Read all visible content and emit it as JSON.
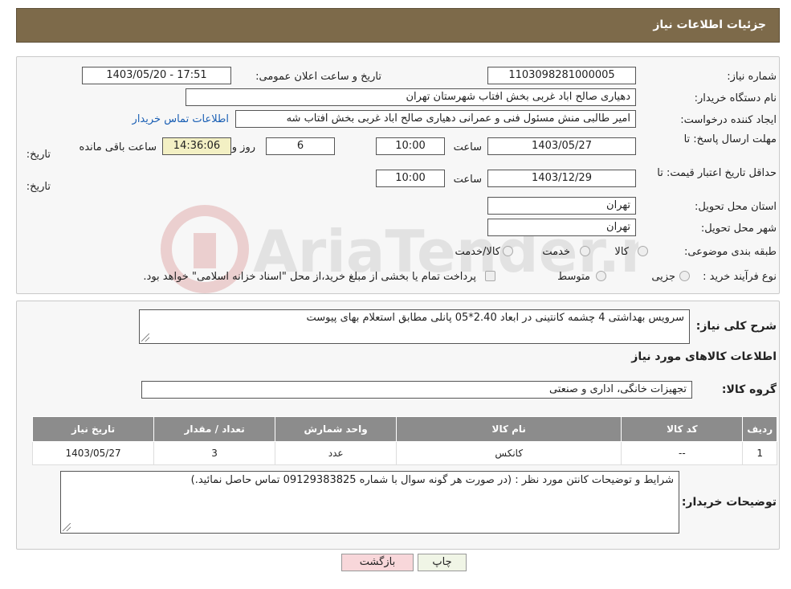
{
  "header": {
    "title": "جزئیات اطلاعات نیاز"
  },
  "watermark": {
    "text": "AriaTender.neT"
  },
  "form": {
    "need_number_label": "شماره نیاز:",
    "need_number_value": "1103098281000005",
    "announce_label": "تاریخ و ساعت اعلان عمومی:",
    "announce_value": "1403/05/20 - 17:51",
    "buyer_org_label": "نام دستگاه خریدار:",
    "buyer_org_value": "دهیاری صالح اباد غربی بخش افتاب شهرستان تهران",
    "creator_label": "ایجاد کننده درخواست:",
    "creator_value": "امیر طالبی منش مسئول فنی و عمرانی دهیاری صالح اباد غربی بخش افتاب شه",
    "contact_link": "اطلاعات تماس خریدار",
    "deadline_label_1": "مهلت ارسال پاسخ: تا",
    "deadline_label_2": "تاریخ:",
    "deadline_date": "1403/05/27",
    "time_label": "ساعت",
    "deadline_time": "10:00",
    "days_value": "6",
    "days_label": "روز و",
    "remaining_time": "14:36:06",
    "remaining_label": "ساعت باقی مانده",
    "validity_label_1": "حداقل تاریخ اعتبار قیمت: تا",
    "validity_label_2": "تاریخ:",
    "validity_date": "1403/12/29",
    "validity_time_label": "ساعت",
    "validity_time": "10:00",
    "province_label": "استان محل تحویل:",
    "province_value": "تهران",
    "city_label": "شهر محل تحویل:",
    "city_value": "تهران",
    "category_label": "طبقه بندی موضوعی:",
    "category_options": [
      "کالا",
      "خدمت",
      "کالا/خدمت"
    ],
    "purchase_type_label": "نوع فرآیند خرید :",
    "purchase_type_options": [
      "جزیی",
      "متوسط"
    ],
    "purchase_note": "پرداخت تمام یا بخشی از مبلغ خرید،از محل \"اسناد خزانه اسلامی\" خواهد بود."
  },
  "description": {
    "label": "شرح کلی نیاز:",
    "value": "سرویس بهداشتی 4 چشمه کانتینی در ابعاد 2.40*05 پانلی مطابق استعلام بهای پیوست"
  },
  "goods": {
    "section_title": "اطلاعات کالاهای مورد نیاز",
    "group_label": "گروه کالا:",
    "group_value": "تجهیزات خانگی، اداری و صنعتی",
    "columns": [
      "ردیف",
      "کد کالا",
      "نام کالا",
      "واحد شمارش",
      "تعداد / مقدار",
      "تاریخ نیاز"
    ],
    "rows": [
      [
        "1",
        "--",
        "کانکس",
        "عدد",
        "3",
        "1403/05/27"
      ]
    ]
  },
  "buyer_notes": {
    "label": "توضیحات خریدار:",
    "value": "شرایط و توضیحات کانتن  مورد نظر : (در صورت هر گونه سوال با شماره 09129383825 تماس حاصل نمائید.)"
  },
  "buttons": {
    "print": "چاپ",
    "back": "بازگشت"
  },
  "colors": {
    "header": "#7d6a4a",
    "table_header": "#8c8c8c",
    "link": "#1a5fb4",
    "back_button": "#f8d7da"
  }
}
